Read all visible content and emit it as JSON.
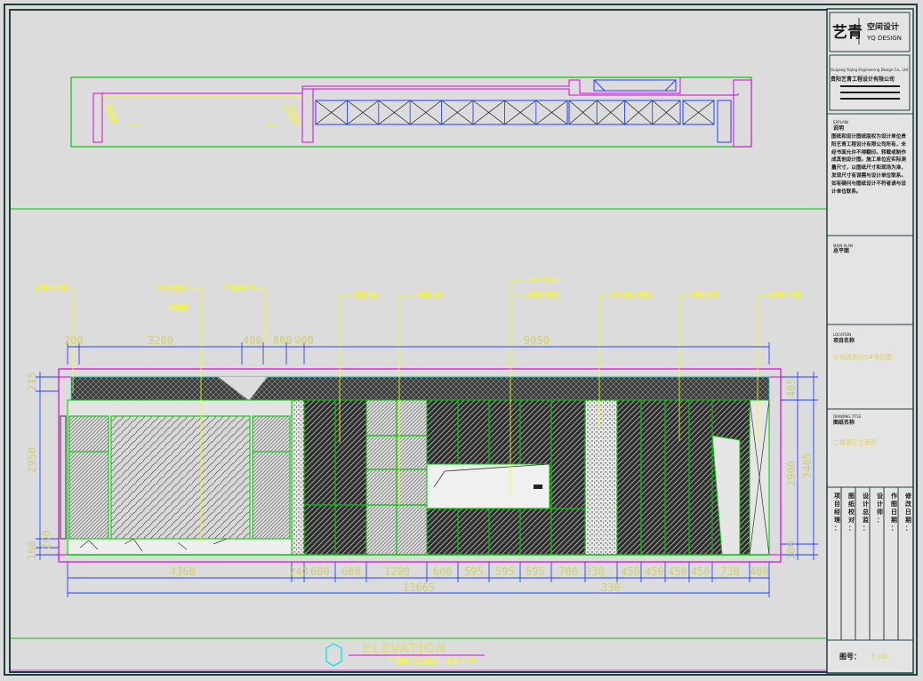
{
  "title_block": {
    "logo_main": "艺青",
    "logo_sub": "空间设计",
    "logo_en": "YQ DESIGN",
    "company_en": "Guiyang Yiqing Engineering Design Co., Ltd",
    "company_cn": "贵阳艺青工程设计有限公司",
    "explain_label_en": "EXPLAIN",
    "explain_label_cn": "说明",
    "explain_text": "图纸和设计图纸版权为设计单位贵阳艺青工程设计有限公司所有，未经书面允许不得翻印。转载或制作成其他设计图。施工单位应实际测量尺寸，以图纸尺寸和现场为准，发现尺寸有误需与设计单位联系。如有疑问与图纸设计不符者请与设计单位联系。",
    "main_plan_en": "MAIN PLAN",
    "main_plan_cn": "总平面",
    "location_en": "LOCATION",
    "location_cn": "项目名称",
    "location_value": "中铁建贵阳5#号别墅",
    "drawing_title_en": "DRAWING TITLE",
    "drawing_title_cn": "图纸名称",
    "drawing_title_value": "二楼客厅立面图",
    "sign_columns": [
      "项目经理：",
      "图纸校对：",
      "设计总监：",
      "设计师：",
      "作图日期：",
      "修改日期："
    ],
    "drawing_no_label": "图号：",
    "drawing_no_value": "E-08"
  },
  "elevation": {
    "top_dims": [
      "200",
      "3200",
      "400",
      "800",
      "900",
      "9050"
    ],
    "left_dims": [
      "215",
      "2950",
      "200",
      "100"
    ],
    "right_dims": [
      "465",
      "2900",
      "3465",
      "100"
    ],
    "bottom_dims": [
      "4360",
      "240",
      "600",
      "600",
      "1200",
      "600",
      "595",
      "595",
      "595",
      "700",
      "330",
      "450",
      "450",
      "450",
      "450",
      "730",
      "400"
    ],
    "total_dim": "13665",
    "total_dim_right": "330",
    "annotations": [
      "防腐木饰面",
      "木纹饰面板",
      "墨镜面",
      "不锈钢饰条",
      "墙纸饰条",
      "墙纸饰面",
      "大理石/墙纸",
      "大理石/墙纸",
      "木饰面/大理石",
      "墙纸饰面",
      "防腐木饰面"
    ]
  },
  "footer": {
    "title_en": "ELEVATION",
    "title_cn": "二楼客厅立面图",
    "scale": "比例 1:50"
  },
  "colors": {
    "green": "#00c800",
    "magenta": "#e000e0",
    "blue": "#2040ff",
    "yellow": "#ffff00",
    "cyan": "#00e0e0",
    "frame": "#1f3f3f"
  }
}
